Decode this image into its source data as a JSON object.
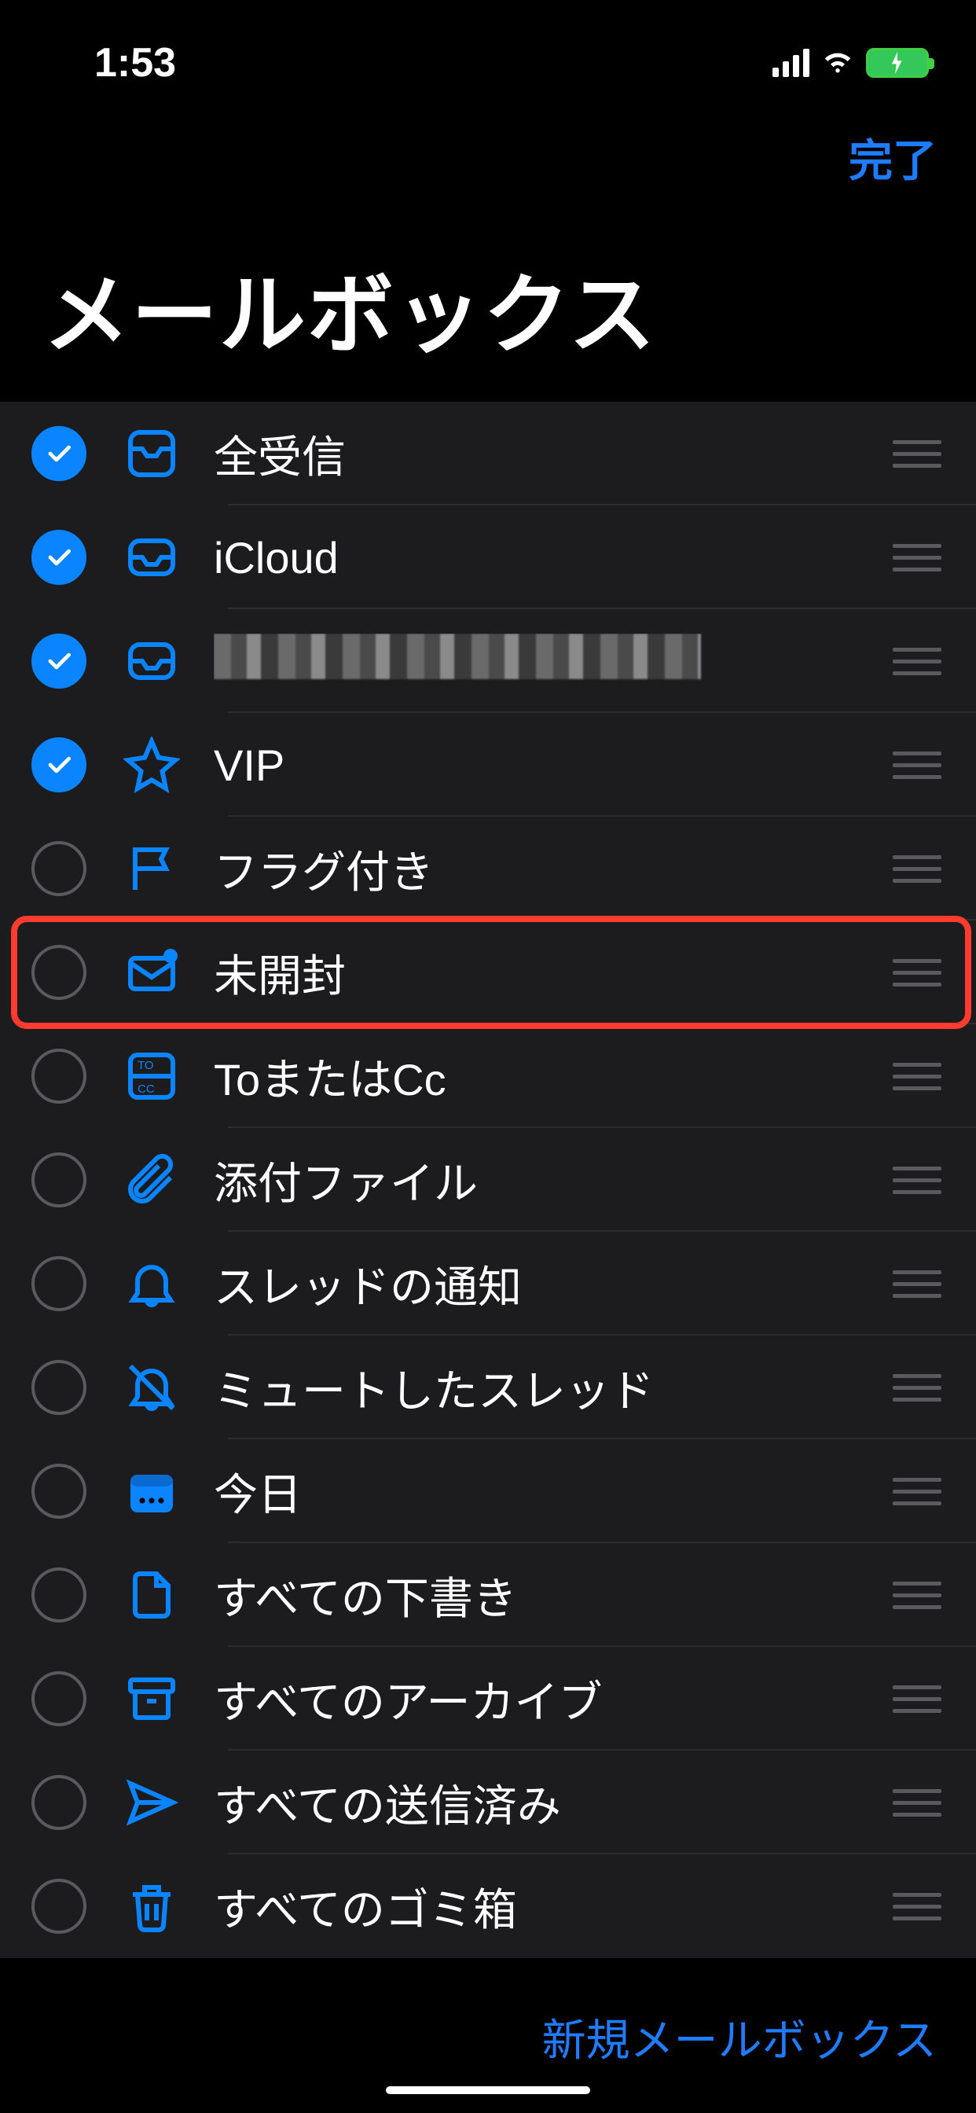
{
  "status": {
    "time": "1:53"
  },
  "nav": {
    "done": "完了"
  },
  "title": "メールボックス",
  "footer": {
    "new_mailbox": "新規メールボックス"
  },
  "mailboxes": [
    {
      "label": "全受信",
      "checked": true,
      "icon": "all-inboxes-icon",
      "highlighted": false,
      "redacted": false
    },
    {
      "label": "iCloud",
      "checked": true,
      "icon": "inbox-icon",
      "highlighted": false,
      "redacted": false
    },
    {
      "label": "",
      "checked": true,
      "icon": "inbox-icon",
      "highlighted": false,
      "redacted": true
    },
    {
      "label": "VIP",
      "checked": true,
      "icon": "star-icon",
      "highlighted": false,
      "redacted": false
    },
    {
      "label": "フラグ付き",
      "checked": false,
      "icon": "flag-icon",
      "highlighted": false,
      "redacted": false
    },
    {
      "label": "未開封",
      "checked": false,
      "icon": "unread-icon",
      "highlighted": true,
      "redacted": false
    },
    {
      "label": "ToまたはCc",
      "checked": false,
      "icon": "to-cc-icon",
      "highlighted": false,
      "redacted": false
    },
    {
      "label": "添付ファイル",
      "checked": false,
      "icon": "attachment-icon",
      "highlighted": false,
      "redacted": false
    },
    {
      "label": "スレッドの通知",
      "checked": false,
      "icon": "bell-icon",
      "highlighted": false,
      "redacted": false
    },
    {
      "label": "ミュートしたスレッド",
      "checked": false,
      "icon": "bell-slash-icon",
      "highlighted": false,
      "redacted": false
    },
    {
      "label": "今日",
      "checked": false,
      "icon": "calendar-icon",
      "highlighted": false,
      "redacted": false
    },
    {
      "label": "すべての下書き",
      "checked": false,
      "icon": "draft-icon",
      "highlighted": false,
      "redacted": false
    },
    {
      "label": "すべてのアーカイブ",
      "checked": false,
      "icon": "archive-icon",
      "highlighted": false,
      "redacted": false
    },
    {
      "label": "すべての送信済み",
      "checked": false,
      "icon": "sent-icon",
      "highlighted": false,
      "redacted": false
    },
    {
      "label": "すべてのゴミ箱",
      "checked": false,
      "icon": "trash-icon",
      "highlighted": false,
      "redacted": false
    }
  ]
}
